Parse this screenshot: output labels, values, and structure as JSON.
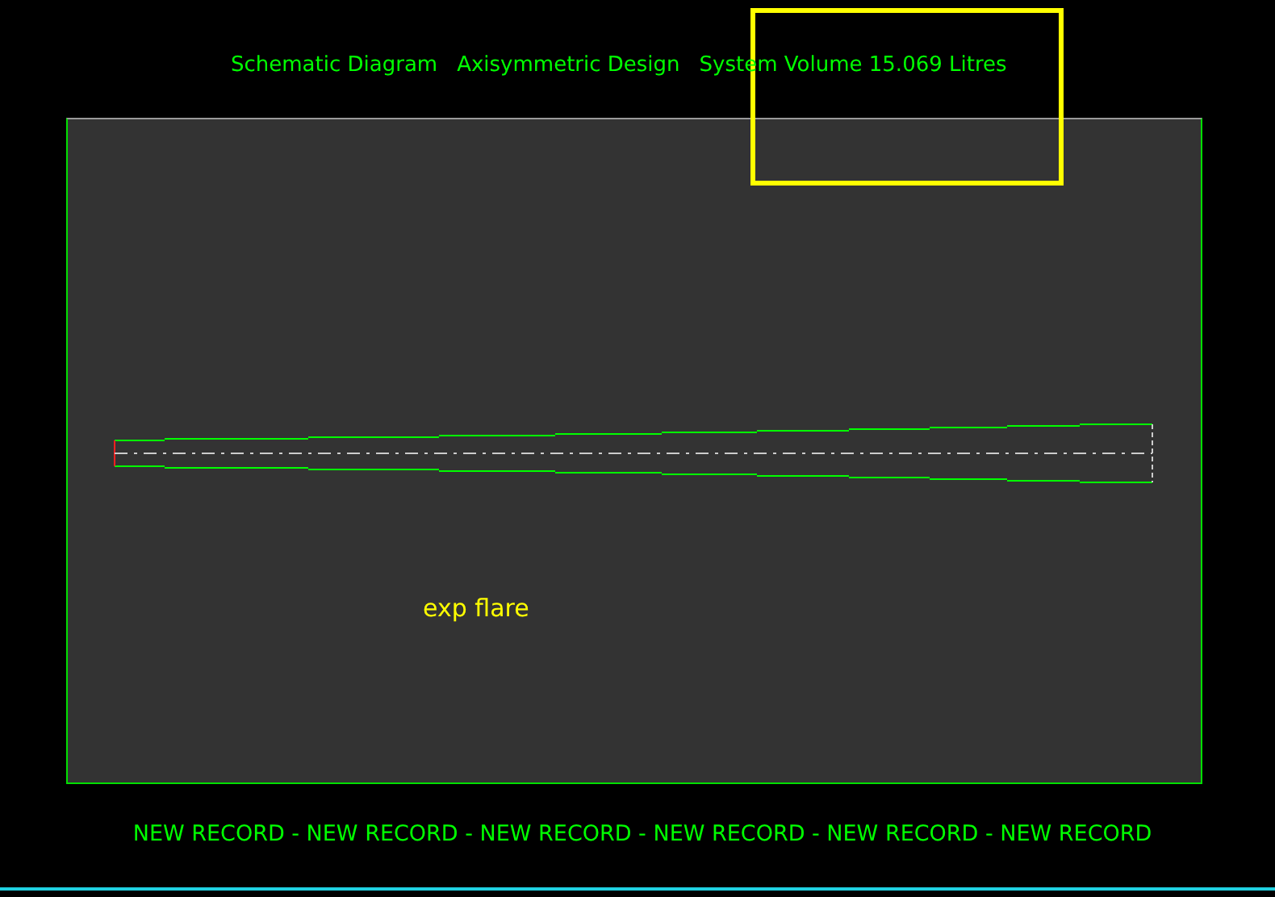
{
  "header": {
    "items": [
      "Schematic Diagram",
      "Axisymmetric Design",
      "System Volume 15.069 Litres"
    ]
  },
  "canvas": {
    "label": "exp flare"
  },
  "status_bar": {
    "text": "NEW RECORD - NEW RECORD - NEW RECORD - NEW RECORD - NEW RECORD - NEW RECORD"
  }
}
